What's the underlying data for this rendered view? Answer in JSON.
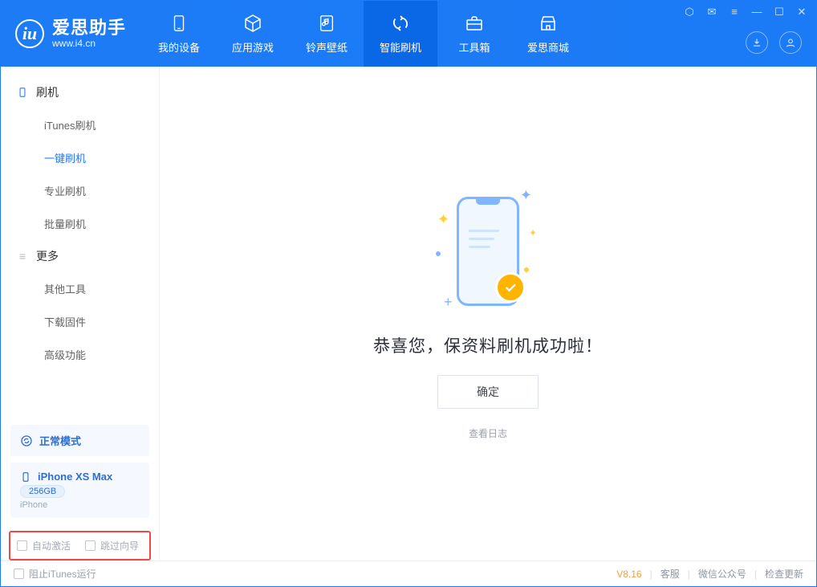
{
  "app": {
    "title": "爱思助手",
    "subtitle": "www.i4.cn",
    "logo_letter": "iu"
  },
  "tabs": {
    "device": "我的设备",
    "apps": "应用游戏",
    "ring": "铃声壁纸",
    "flash": "智能刷机",
    "toolbox": "工具箱",
    "store": "爱思商城"
  },
  "sidebar": {
    "section_flash": "刷机",
    "items_flash": {
      "itunes": "iTunes刷机",
      "onekey": "一键刷机",
      "pro": "专业刷机",
      "batch": "批量刷机"
    },
    "section_more": "更多",
    "items_more": {
      "other": "其他工具",
      "firmware": "下载固件",
      "advanced": "高级功能"
    }
  },
  "device": {
    "mode": "正常模式",
    "name": "iPhone XS Max",
    "capacity": "256GB",
    "type": "iPhone"
  },
  "options": {
    "auto_activate": "自动激活",
    "skip_guide": "跳过向导"
  },
  "main": {
    "message": "恭喜您，保资料刷机成功啦！",
    "confirm": "确定",
    "view_log": "查看日志"
  },
  "footer": {
    "block_itunes": "阻止iTunes运行",
    "version": "V8.16",
    "support": "客服",
    "wechat": "微信公众号",
    "update": "检查更新"
  }
}
